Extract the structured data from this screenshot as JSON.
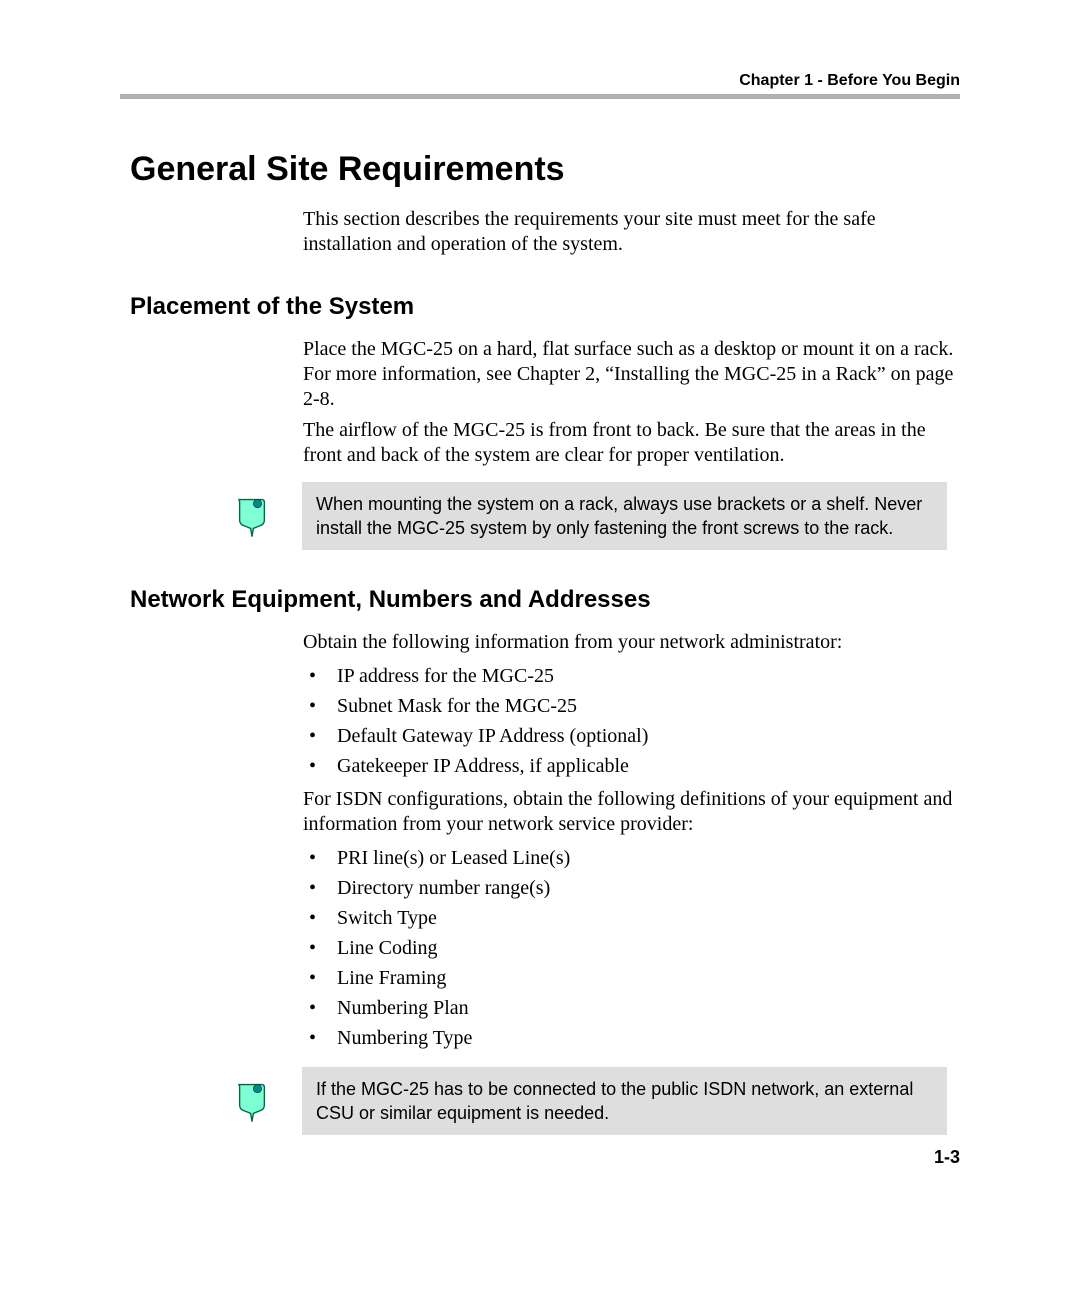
{
  "header": {
    "chapter": "Chapter 1 - Before You Begin"
  },
  "title": "General Site Requirements",
  "intro": "This section describes the requirements your site must meet for the safe installation and operation of the system.",
  "sections": {
    "placement": {
      "heading": "Placement of the System",
      "p1": "Place the MGC-25 on a hard, flat surface such as a desktop or mount it on a rack. For more information, see Chapter  2, “Installing the MGC-25 in a Rack” on page 2-8.",
      "p2": "The airflow of the MGC-25 is from front to back. Be sure that the areas in the front and back of the system are clear for proper ventilation.",
      "note": "When mounting the system on a rack, always use brackets or a shelf. Never install the MGC-25 system by only fastening the front screws to the rack."
    },
    "network": {
      "heading": "Network Equipment, Numbers and Addresses",
      "p1": "Obtain the following information from your network administrator:",
      "list1": [
        "IP address for the MGC-25",
        "Subnet Mask for the MGC-25",
        "Default Gateway IP Address (optional)",
        "Gatekeeper IP Address, if applicable"
      ],
      "p2": "For ISDN configurations, obtain the following definitions of your equipment and information from your network service provider:",
      "list2": [
        "PRI line(s) or Leased Line(s)",
        "Directory number range(s)",
        "Switch Type",
        "Line Coding",
        "Line Framing",
        "Numbering Plan",
        "Numbering Type"
      ],
      "note": "If the MGC-25 has to be connected to the public ISDN network, an external CSU or similar equipment is needed."
    }
  },
  "footer": {
    "page_number": "1-3"
  }
}
